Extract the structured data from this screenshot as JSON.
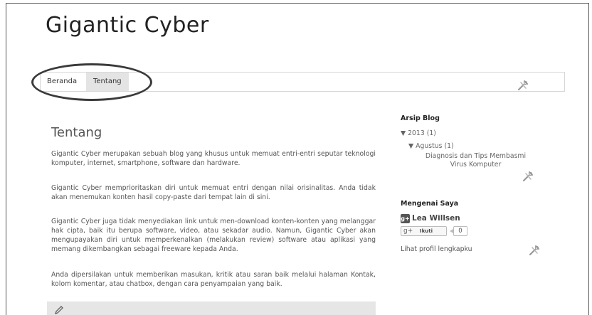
{
  "blog": {
    "title": "Gigantic Cyber"
  },
  "nav": {
    "tabs": [
      {
        "label": "Beranda"
      },
      {
        "label": "Tentang"
      }
    ]
  },
  "post": {
    "title": "Tentang",
    "paragraphs": [
      "Gigantic Cyber merupakan sebuah blog yang khusus untuk memuat entri-entri seputar teknologi komputer, internet, smartphone, software dan hardware.",
      "Gigantic Cyber memprioritaskan diri untuk memuat entri dengan nilai orisinalitas. Anda tidak akan menemukan konten hasil copy-paste dari tempat lain di sini.",
      "Gigantic Cyber juga tidak menyediakan link untuk men-download konten-konten yang melanggar hak cipta, baik itu berupa software, video, atau sekadar audio. Namun, Gigantic Cyber akan mengupayakan diri untuk memperkenalkan (melakukan review) software atau aplikasi yang memang dikembangkan sebagai freeware kepada Anda.",
      "Anda dipersilakan untuk memberikan masukan, kritik atau saran baik melalui halaman Kontak, kolom komentar, atau chatbox, dengan cara penyampaian yang baik."
    ]
  },
  "sidebar": {
    "archive": {
      "heading": "Arsip Blog",
      "year": "▼ 2013 (1)",
      "month": "▼ Agustus (1)",
      "post": "Diagnosis dan Tips Membasmi Virus Komputer"
    },
    "about": {
      "heading": "Mengenai Saya",
      "gplus_badge": "g+",
      "name": "Lea Willsen",
      "follow_gplus": "g+",
      "follow_label": "Ikuti",
      "follow_count": "0",
      "profile_link": "Lihat profil lengkapku"
    }
  },
  "icons": {
    "wrench": "wrench-screwdriver-icon",
    "pencil": "pencil-icon",
    "gplus": "google-plus-icon"
  }
}
